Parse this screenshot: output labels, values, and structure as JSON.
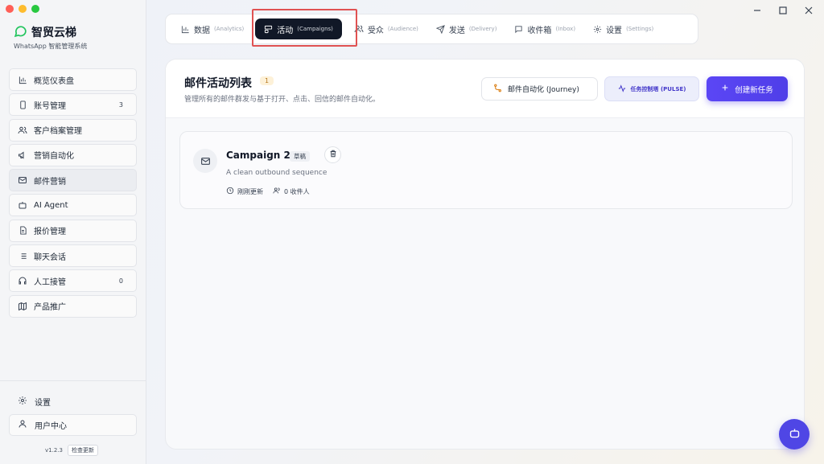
{
  "colors": {
    "accent": "#4f46e5",
    "brand": "#22c55e",
    "tab_active": "#111827",
    "highlight": "#e05252"
  },
  "sidebar": {
    "brand_name": "智贸云梯",
    "brand_subtitle": "WhatsApp 智能管理系统",
    "items": [
      {
        "label": "概览仪表盘",
        "icon": "bar-chart-icon",
        "count": ""
      },
      {
        "label": "账号管理",
        "icon": "phone-icon",
        "count": "3"
      },
      {
        "label": "客户档案管理",
        "icon": "users-icon",
        "count": ""
      },
      {
        "label": "营销自动化",
        "icon": "megaphone-icon",
        "count": ""
      },
      {
        "label": "邮件营销",
        "icon": "mail-icon",
        "count": ""
      },
      {
        "label": "AI Agent",
        "icon": "bot-icon",
        "count": ""
      },
      {
        "label": "报价管理",
        "icon": "file-icon",
        "count": ""
      },
      {
        "label": "聊天会话",
        "icon": "list-icon",
        "count": ""
      },
      {
        "label": "人工接管",
        "icon": "headset-icon",
        "count": "0"
      },
      {
        "label": "产品推广",
        "icon": "map-icon",
        "count": ""
      }
    ],
    "settings_label": "设置",
    "user_center_label": "用户中心",
    "version": "v1.2.3",
    "check_update_label": "检查更新"
  },
  "tabs": [
    {
      "label": "数据",
      "sub": "(Analytics)",
      "icon": "bar-chart-icon"
    },
    {
      "label": "活动",
      "sub": "(Campaigns)",
      "icon": "layout-icon"
    },
    {
      "label": "受众",
      "sub": "(Audience)",
      "icon": "users-icon"
    },
    {
      "label": "发送",
      "sub": "(Delivery)",
      "icon": "send-icon"
    },
    {
      "label": "收件箱",
      "sub": "(Inbox)",
      "icon": "message-icon"
    },
    {
      "label": "设置",
      "sub": "(Settings)",
      "icon": "gear-icon"
    }
  ],
  "main": {
    "title": "邮件活动列表",
    "count_badge": "1",
    "description": "管理所有的邮件群发与基于打开、点击、回信的邮件自动化。",
    "journey_label": "邮件自动化 (Journey)",
    "pulse_label": "任务控制塔 (PULSE)",
    "create_label": "创建新任务"
  },
  "campaigns": [
    {
      "name": "Campaign 2",
      "status": "草稿",
      "description": "A clean outbound sequence",
      "updated": "刚刚更新",
      "recipients": "0 收件人"
    }
  ]
}
